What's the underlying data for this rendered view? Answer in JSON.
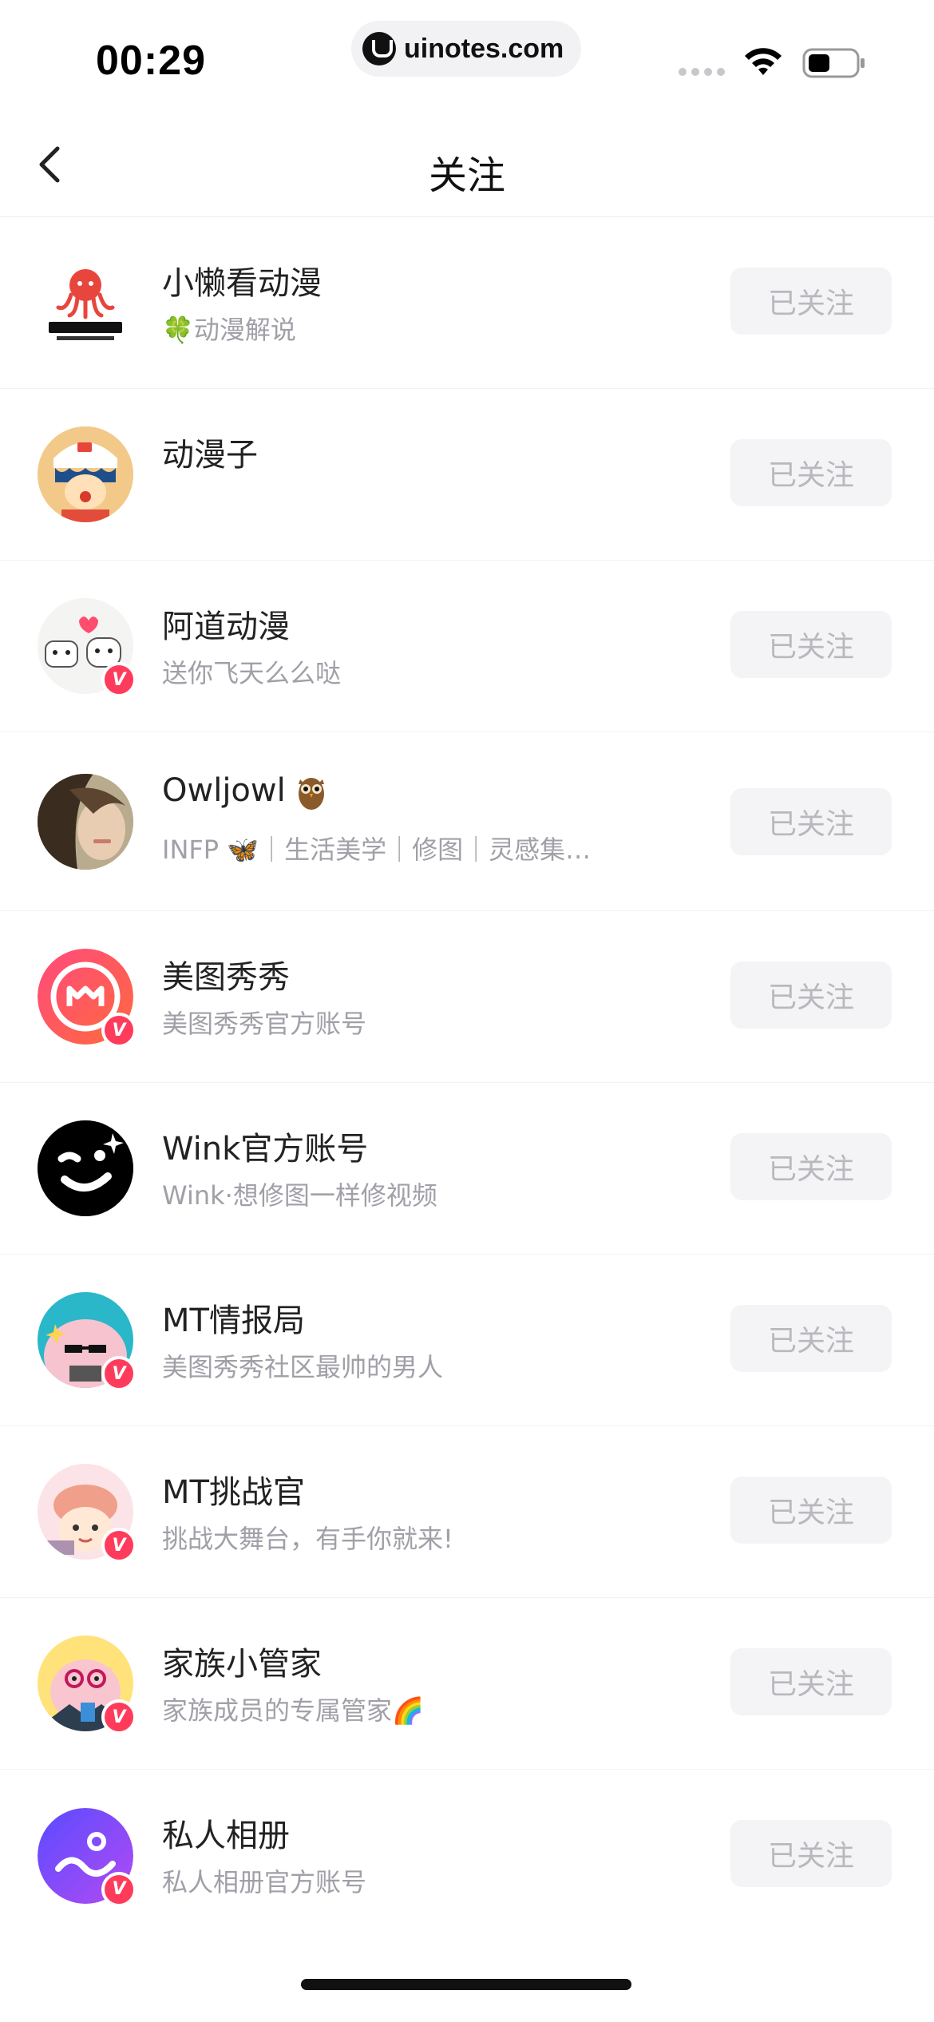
{
  "status_bar": {
    "time": "00:29",
    "url": "uinotes.com"
  },
  "nav": {
    "title": "关注"
  },
  "follow_label": "已关注",
  "accounts": [
    {
      "name": "小懒看动漫",
      "desc": "🍀动漫解说",
      "verified": false,
      "avatar": "octopus-mama-logo"
    },
    {
      "name": "动漫子",
      "desc": "",
      "verified": false,
      "avatar": "anime-boy"
    },
    {
      "name": "阿道动漫",
      "desc": "送你飞天么么哒",
      "verified": true,
      "avatar": "cartoon-couple"
    },
    {
      "name": "Owljowl",
      "desc": "INFP 🦋｜生活美学｜修图｜灵感集…",
      "verified": false,
      "avatar": "photo-portrait"
    },
    {
      "name": "美图秀秀",
      "desc": "美图秀秀官方账号",
      "verified": true,
      "avatar": "meitu-logo"
    },
    {
      "name": "Wink官方账号",
      "desc": "Wink·想修图一样修视频",
      "verified": false,
      "avatar": "wink-logo"
    },
    {
      "name": "MT情报局",
      "desc": "美图秀秀社区最帅的男人",
      "verified": true,
      "avatar": "mt-mascot"
    },
    {
      "name": "MT挑战官",
      "desc": "挑战大舞台，有手你就来!",
      "verified": true,
      "avatar": "mt-challenge-mascot"
    },
    {
      "name": "家族小管家",
      "desc": "家族成员的专属管家🌈",
      "verified": true,
      "avatar": "family-mascot"
    },
    {
      "name": "私人相册",
      "desc": "私人相册官方账号",
      "verified": true,
      "avatar": "album-logo"
    }
  ],
  "colors": {
    "verified_badge": "#ff3b5c",
    "button_bg": "#f4f4f6",
    "button_text": "#b8b8bd",
    "desc_text": "#a0a0a8"
  }
}
